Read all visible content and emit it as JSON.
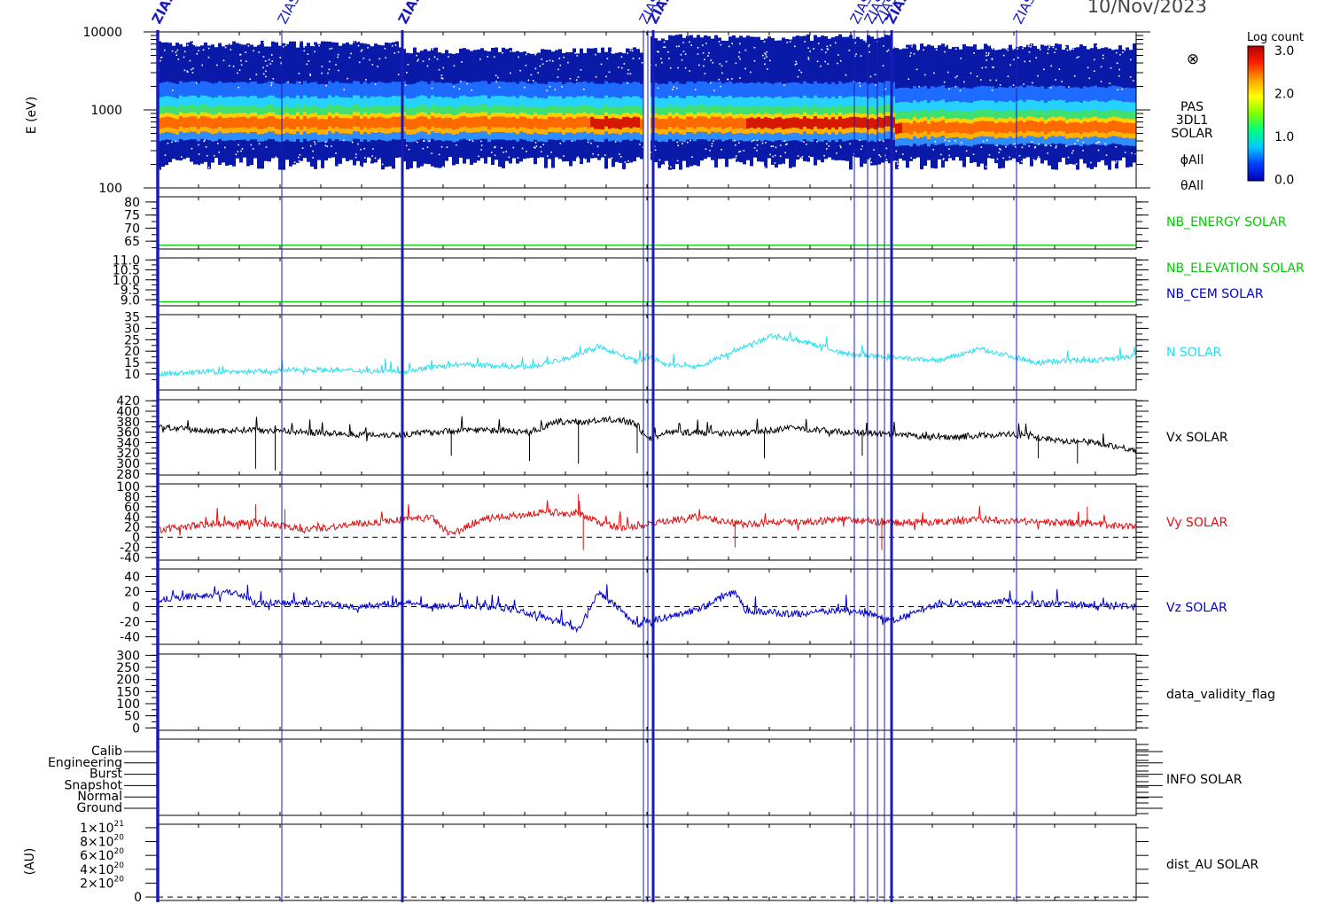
{
  "header": {
    "date": "10/Nov/2023"
  },
  "colorbar": {
    "title": "Log count",
    "ticks": [
      "3.0",
      "2.0",
      "1.0",
      "0.0"
    ],
    "stops": [
      "#0000b0",
      "#0040ff",
      "#00c8ff",
      "#00ff80",
      "#80ff00",
      "#ffff00",
      "#ffa000",
      "#ff2000",
      "#b00000"
    ]
  },
  "event_markers": {
    "labels": [
      "ZIAS",
      "ZIAS",
      "ZIAS",
      "ZIAS",
      "ZIAS",
      "ZIAS",
      "ZIAS",
      "ZIAS",
      "ZIAS",
      "ZIAS",
      "ZIAS"
    ],
    "color": "#1a1ab8"
  },
  "chart_data": [
    {
      "type": "heatmap",
      "panel": "pas-spectrogram",
      "ylabel": "E (eV)",
      "yscale": "log",
      "ylim": [
        100,
        10000
      ],
      "tick_labels": [
        "10000",
        "1000",
        "100"
      ],
      "side_labels": [
        "PAS",
        "3DL1",
        "SOLAR"
      ],
      "angle_labels": [
        "ϕAll",
        "θAll"
      ],
      "symbol": "⊗",
      "peak_energy_eV": 700,
      "band_energy_eV": [
        200,
        7000
      ],
      "colorbar_range": [
        0.0,
        3.0
      ]
    },
    {
      "type": "line",
      "panel": "nb-energy",
      "name": "NB_ENERGY SOLAR",
      "color": "#00cc00",
      "ylim": [
        62,
        82
      ],
      "ticks": [
        65,
        70,
        75,
        80
      ],
      "constant": 63.5
    },
    {
      "type": "line",
      "panel": "nb-elevation-cem",
      "series": [
        {
          "name": "NB_ELEVATION SOLAR",
          "color": "#00cc00",
          "constant": 8.9
        },
        {
          "name": "NB_CEM SOLAR",
          "color": "#0000cc"
        }
      ],
      "ylim": [
        8.7,
        11.1
      ],
      "ticks": [
        9.0,
        9.5,
        10.0,
        10.5,
        11.0
      ]
    },
    {
      "type": "line",
      "panel": "density",
      "name": "N SOLAR",
      "color": "#22dfef",
      "ylim": [
        3,
        36
      ],
      "ticks": [
        10,
        15,
        20,
        25,
        30,
        35
      ],
      "x": [
        0,
        0.05,
        0.1,
        0.15,
        0.25,
        0.28,
        0.32,
        0.38,
        0.42,
        0.45,
        0.47,
        0.49,
        0.5,
        0.52,
        0.55,
        0.59,
        0.63,
        0.66,
        0.68,
        0.7,
        0.75,
        0.8,
        0.84,
        0.87,
        0.9,
        0.94,
        0.96,
        1.0
      ],
      "values": [
        10,
        11,
        11,
        12,
        11,
        13,
        14,
        13,
        17,
        22,
        19,
        15,
        18,
        14,
        13,
        20,
        27,
        24,
        22,
        19,
        17,
        16,
        21,
        18,
        15,
        16,
        16,
        18
      ]
    },
    {
      "type": "line",
      "panel": "vx",
      "name": "Vx SOLAR",
      "color": "#000000",
      "ylim": [
        278,
        422
      ],
      "ticks": [
        280,
        300,
        320,
        340,
        360,
        380,
        400,
        420
      ],
      "x": [
        0,
        0.05,
        0.1,
        0.15,
        0.2,
        0.25,
        0.28,
        0.32,
        0.38,
        0.41,
        0.44,
        0.47,
        0.49,
        0.5,
        0.52,
        0.6,
        0.65,
        0.7,
        0.75,
        0.8,
        0.87,
        0.92,
        0.96,
        1.0
      ],
      "values": [
        370,
        362,
        365,
        360,
        356,
        355,
        360,
        365,
        360,
        380,
        380,
        385,
        375,
        345,
        360,
        358,
        368,
        360,
        355,
        350,
        356,
        345,
        340,
        325
      ],
      "spikes": [
        [
          0.1,
          290
        ],
        [
          0.12,
          287
        ],
        [
          0.3,
          315
        ],
        [
          0.38,
          305
        ],
        [
          0.43,
          300
        ],
        [
          0.49,
          320
        ],
        [
          0.62,
          310
        ],
        [
          0.72,
          315
        ],
        [
          0.9,
          310
        ],
        [
          0.94,
          300
        ]
      ]
    },
    {
      "type": "line",
      "panel": "vy",
      "name": "Vy SOLAR",
      "color": "#e01010",
      "ylim": [
        -45,
        105
      ],
      "ticks": [
        -40,
        -20,
        0,
        20,
        40,
        60,
        80,
        100
      ],
      "dashed_at": 0,
      "x": [
        0,
        0.05,
        0.1,
        0.15,
        0.2,
        0.25,
        0.28,
        0.3,
        0.33,
        0.4,
        0.43,
        0.45,
        0.47,
        0.49,
        0.5,
        0.55,
        0.6,
        0.63,
        0.66,
        0.7,
        0.75,
        0.8,
        0.85,
        0.9,
        0.95,
        1.0
      ],
      "values": [
        15,
        25,
        30,
        15,
        25,
        35,
        38,
        5,
        35,
        50,
        45,
        30,
        20,
        20,
        25,
        40,
        25,
        30,
        30,
        35,
        28,
        30,
        35,
        30,
        27,
        20
      ],
      "spikes": [
        [
          0.1,
          65
        ],
        [
          0.13,
          55
        ],
        [
          0.43,
          85
        ],
        [
          0.435,
          -25
        ],
        [
          0.59,
          -20
        ],
        [
          0.74,
          -25
        ],
        [
          0.95,
          60
        ]
      ]
    },
    {
      "type": "line",
      "panel": "vz",
      "name": "Vz SOLAR",
      "color": "#0000cc",
      "ylim": [
        -50,
        50
      ],
      "ticks": [
        -40,
        -20,
        0,
        20,
        40
      ],
      "dashed_at": 0,
      "x": [
        0,
        0.05,
        0.08,
        0.1,
        0.15,
        0.2,
        0.25,
        0.3,
        0.35,
        0.4,
        0.43,
        0.45,
        0.47,
        0.49,
        0.5,
        0.55,
        0.59,
        0.6,
        0.65,
        0.7,
        0.73,
        0.75,
        0.8,
        0.84,
        0.86,
        0.9,
        0.95,
        1.0
      ],
      "values": [
        10,
        15,
        20,
        5,
        5,
        0,
        5,
        0,
        0,
        -15,
        -30,
        20,
        0,
        -25,
        -20,
        -5,
        20,
        -5,
        -10,
        -5,
        -10,
        -20,
        5,
        3,
        8,
        5,
        2,
        0
      ]
    },
    {
      "type": "line",
      "panel": "validity",
      "name": "data_validity_flag",
      "ylim": [
        -10,
        305
      ],
      "ticks": [
        0,
        50,
        100,
        150,
        200,
        250,
        300
      ]
    },
    {
      "type": "line",
      "panel": "info",
      "name": "INFO SOLAR",
      "categories": [
        "Calib",
        "Engineering",
        "Burst",
        "Snapshot",
        "Normal",
        "Ground"
      ]
    },
    {
      "type": "line",
      "panel": "dist",
      "name": "dist_AU SOLAR",
      "ylabel": "(AU)",
      "dashed_at": 0,
      "ylim": [
        -5e+19,
        1.05e+21
      ],
      "tick_labels": [
        {
          "mant": "1×10",
          "exp": "21",
          "value": 1e+21
        },
        {
          "mant": "8×10",
          "exp": "20",
          "value": 8e+20
        },
        {
          "mant": "6×10",
          "exp": "20",
          "value": 6e+20
        },
        {
          "mant": "4×10",
          "exp": "20",
          "value": 4e+20
        },
        {
          "mant": "2×10",
          "exp": "20",
          "value": 2e+20
        },
        {
          "mant": "0",
          "exp": "",
          "value": 0
        }
      ]
    }
  ]
}
